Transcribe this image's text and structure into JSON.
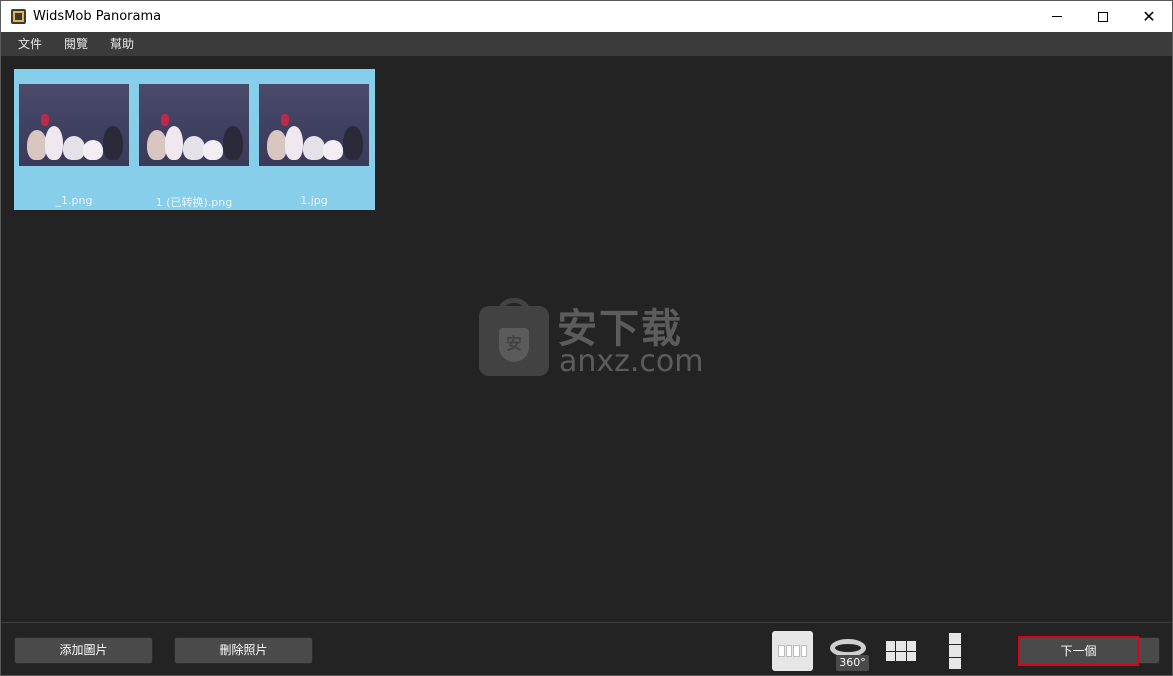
{
  "window": {
    "title": "WidsMob Panorama",
    "controls": {
      "minimize": "minimize-icon",
      "maximize": "maximize-icon",
      "close": "close-icon"
    }
  },
  "menu": {
    "items": [
      "文件",
      "閱覽",
      "幫助"
    ]
  },
  "thumbnails": [
    {
      "label": "_1.png"
    },
    {
      "label": "1 (已转换).png"
    },
    {
      "label": "1.jpg"
    }
  ],
  "watermark": {
    "chinese": "安下载",
    "english": "anxz.com",
    "shield_char": "安"
  },
  "toolbar": {
    "add_label": "添加圖片",
    "delete_label": "刪除照片",
    "next_label": "下一個",
    "mode_360_label": "360°",
    "modes": [
      "horizontal-panorama-icon",
      "360-panorama-icon",
      "grid-panorama-icon",
      "vertical-panorama-icon"
    ]
  },
  "colors": {
    "thumbnail_selection": "#87ceeb",
    "canvas_background": "#232323",
    "highlight_border": "#e0001a"
  }
}
